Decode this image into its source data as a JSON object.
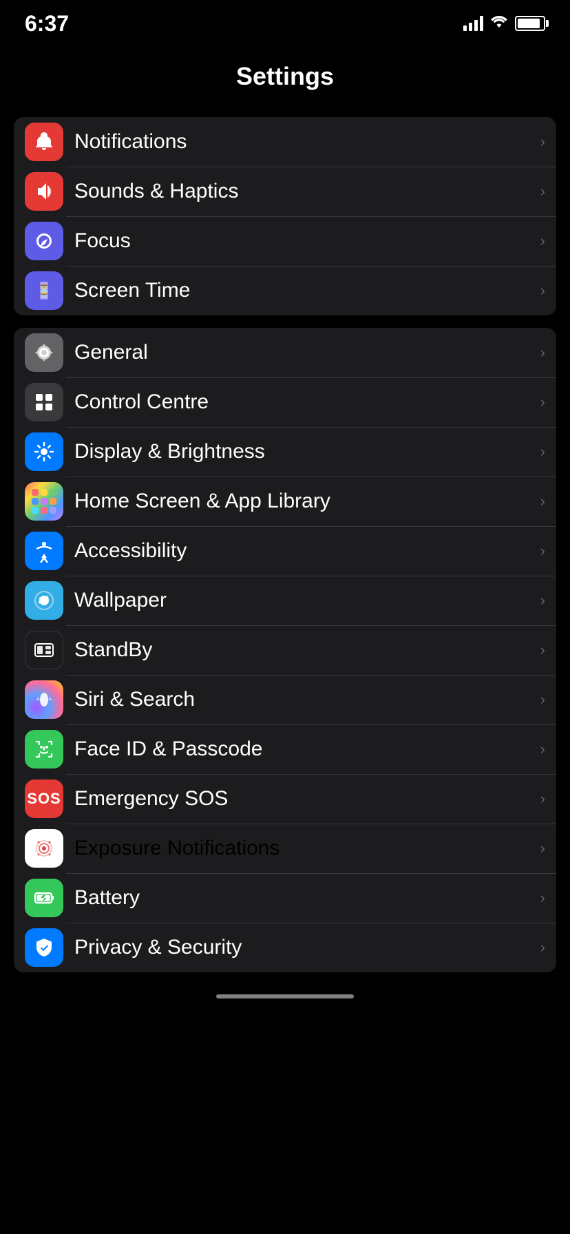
{
  "statusBar": {
    "time": "6:37"
  },
  "header": {
    "title": "Settings"
  },
  "groups": [
    {
      "id": "group1",
      "items": [
        {
          "id": "notifications",
          "label": "Notifications",
          "iconType": "red",
          "iconSymbol": "bell"
        },
        {
          "id": "sounds-haptics",
          "label": "Sounds & Haptics",
          "iconType": "pink-red",
          "iconSymbol": "speaker"
        },
        {
          "id": "focus",
          "label": "Focus",
          "iconType": "purple",
          "iconSymbol": "moon"
        },
        {
          "id": "screen-time",
          "label": "Screen Time",
          "iconType": "deep-purple",
          "iconSymbol": "hourglass"
        }
      ]
    },
    {
      "id": "group2",
      "items": [
        {
          "id": "general",
          "label": "General",
          "iconType": "gray",
          "iconSymbol": "gear"
        },
        {
          "id": "control-centre",
          "label": "Control Centre",
          "iconType": "dark-gray",
          "iconSymbol": "sliders"
        },
        {
          "id": "display-brightness",
          "label": "Display & Brightness",
          "iconType": "blue",
          "iconSymbol": "sun"
        },
        {
          "id": "home-screen",
          "label": "Home Screen & App Library",
          "iconType": "home-screen",
          "iconSymbol": "grid"
        },
        {
          "id": "accessibility",
          "label": "Accessibility",
          "iconType": "blue",
          "iconSymbol": "accessibility"
        },
        {
          "id": "wallpaper",
          "label": "Wallpaper",
          "iconType": "light-blue",
          "iconSymbol": "flower"
        },
        {
          "id": "standby",
          "label": "StandBy",
          "iconType": "standby",
          "iconSymbol": "standby"
        },
        {
          "id": "siri-search",
          "label": "Siri & Search",
          "iconType": "gradient-siri",
          "iconSymbol": "siri"
        },
        {
          "id": "face-id",
          "label": "Face ID & Passcode",
          "iconType": "green",
          "iconSymbol": "faceid"
        },
        {
          "id": "emergency-sos",
          "label": "Emergency SOS",
          "iconType": "sos-red",
          "iconSymbol": "sos"
        },
        {
          "id": "exposure",
          "label": "Exposure Notifications",
          "iconType": "white",
          "iconSymbol": "exposure"
        },
        {
          "id": "battery",
          "label": "Battery",
          "iconType": "green",
          "iconSymbol": "battery"
        },
        {
          "id": "privacy-security",
          "label": "Privacy & Security",
          "iconType": "blue",
          "iconSymbol": "hand"
        }
      ]
    }
  ],
  "chevron": "›"
}
